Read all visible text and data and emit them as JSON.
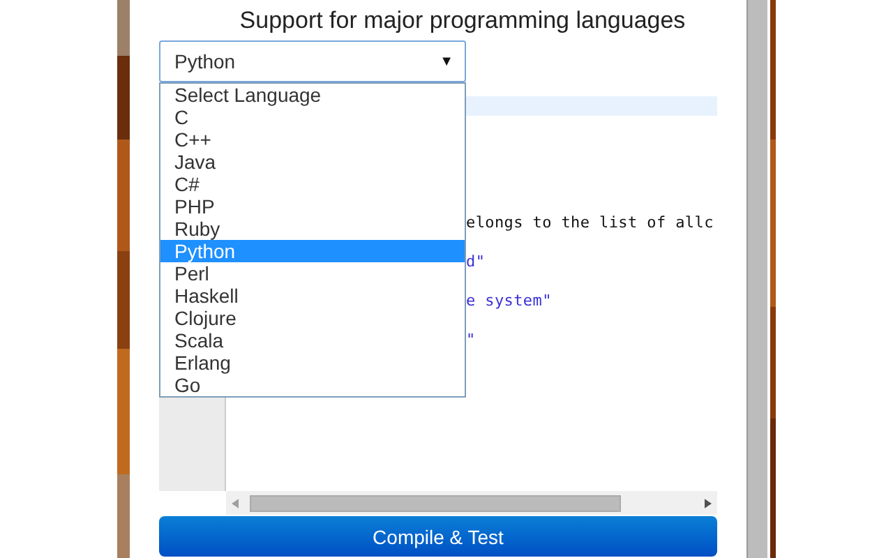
{
  "heading": "Support for major programming languages",
  "language_select": {
    "value": "Python",
    "arrow": "▼",
    "expanded": true,
    "options": [
      {
        "label": "Select Language",
        "selected": false
      },
      {
        "label": "C",
        "selected": false
      },
      {
        "label": "C++",
        "selected": false
      },
      {
        "label": "Java",
        "selected": false
      },
      {
        "label": "C#",
        "selected": false
      },
      {
        "label": "PHP",
        "selected": false
      },
      {
        "label": "Ruby",
        "selected": false
      },
      {
        "label": "Python",
        "selected": true
      },
      {
        "label": "Perl",
        "selected": false
      },
      {
        "label": "Haskell",
        "selected": false
      },
      {
        "label": "Clojure",
        "selected": false
      },
      {
        "label": "Scala",
        "selected": false
      },
      {
        "label": "Erlang",
        "selected": false
      },
      {
        "label": "Go",
        "selected": false
      }
    ]
  },
  "code_lines": [
    {
      "text": "elongs to the list of allc",
      "kind": "plain"
    },
    {
      "text": "d\"",
      "kind": "string"
    },
    {
      "text": "e system\"",
      "kind": "string"
    },
    {
      "text": "\"",
      "kind": "string"
    }
  ],
  "compile_button": "Compile & Test"
}
